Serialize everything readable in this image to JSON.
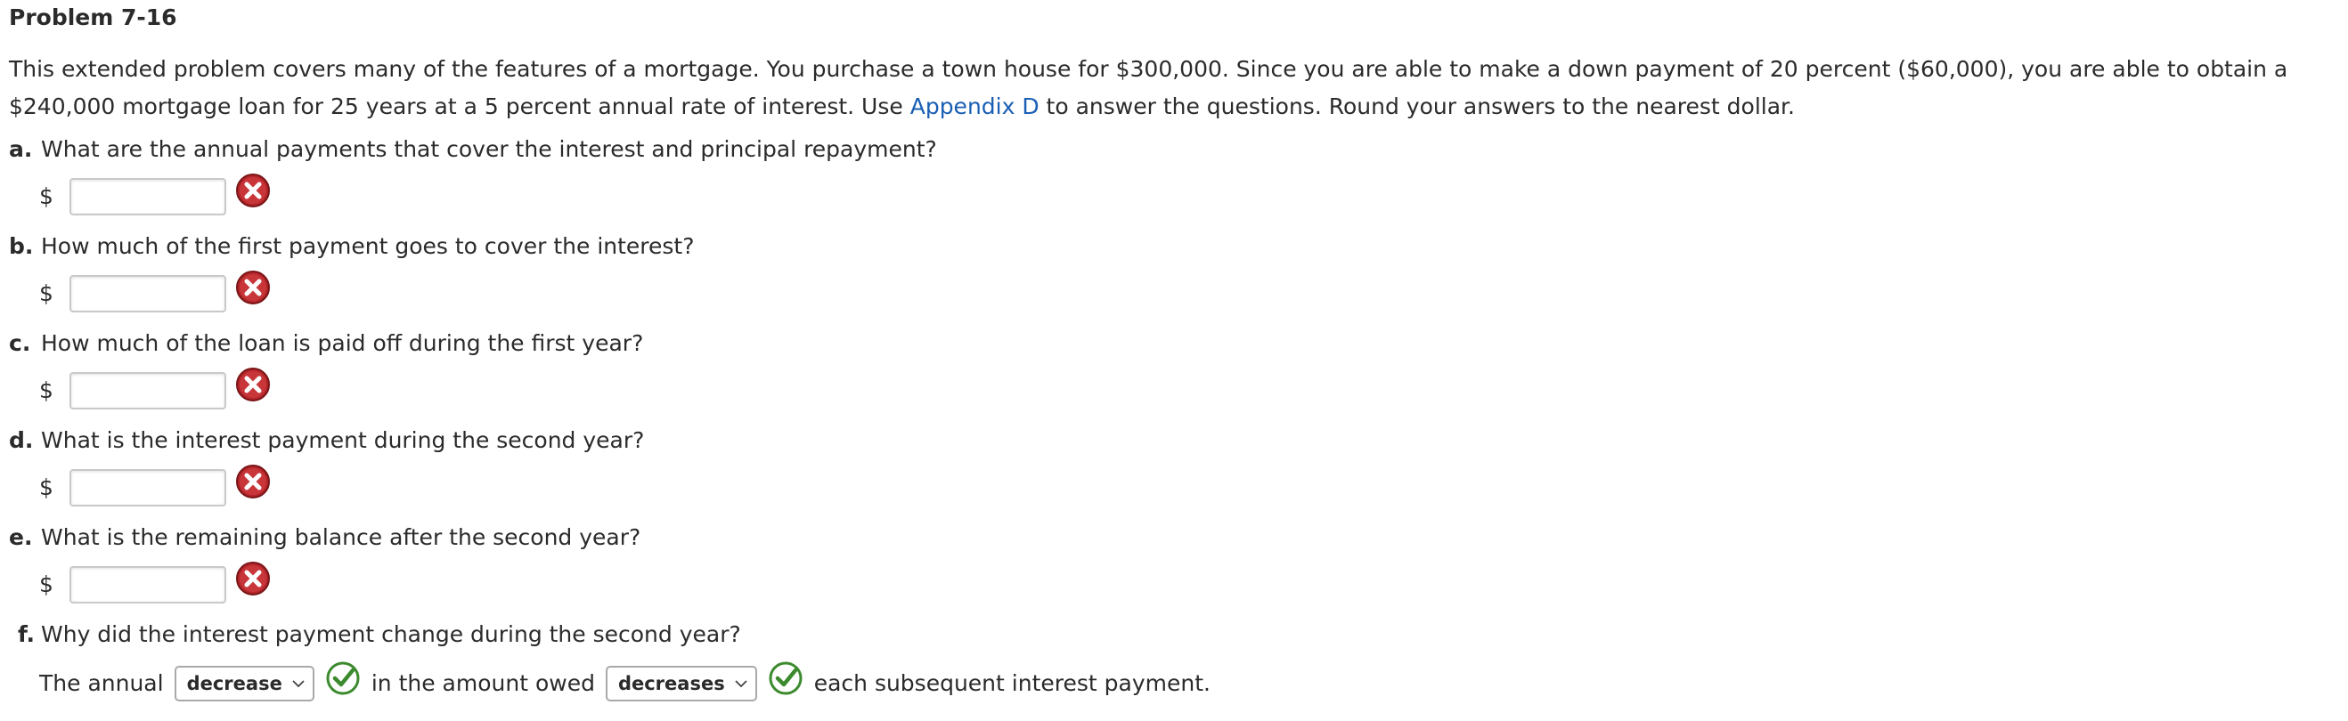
{
  "problem": {
    "title": "Problem 7-16",
    "intro_before_link": "This extended problem covers many of the features of a mortgage. You purchase a town house for $300,000. Since you are able to make a down payment of 20 percent ($60,000), you are able to obtain a $240,000 mortgage loan for 25 years at a 5 percent annual rate of interest. Use ",
    "intro_link": "Appendix D",
    "intro_after_link": " to answer the questions. Round your answers to the nearest dollar."
  },
  "questions": [
    {
      "letter": "a.",
      "text": "What are the annual payments that cover the interest and principal repayment?",
      "currency": "$",
      "value": "",
      "status_icon": "incorrect-x-icon"
    },
    {
      "letter": "b.",
      "text": "How much of the first payment goes to cover the interest?",
      "currency": "$",
      "value": "",
      "status_icon": "incorrect-x-icon"
    },
    {
      "letter": "c.",
      "text": "How much of the loan is paid off during the first year?",
      "currency": "$",
      "value": "",
      "status_icon": "incorrect-x-icon"
    },
    {
      "letter": "d.",
      "text": "What is the interest payment during the second year?",
      "currency": "$",
      "value": "",
      "status_icon": "incorrect-x-icon"
    },
    {
      "letter": "e.",
      "text": "What is the remaining balance after the second year?",
      "currency": "$",
      "value": "",
      "status_icon": "incorrect-x-icon"
    }
  ],
  "question_f": {
    "letter": "f.",
    "text": "Why did the interest payment change during the second year?",
    "part1": "The annual",
    "select1": "decrease",
    "part2": "in the amount owed",
    "select2": "decreases",
    "part3": "each subsequent interest payment.",
    "status_icon": "correct-check-icon"
  },
  "colors": {
    "link": "#1a5fb4",
    "incorrect": "#b3262a",
    "correct": "#3c8a2e",
    "text": "#2b2b2b"
  }
}
